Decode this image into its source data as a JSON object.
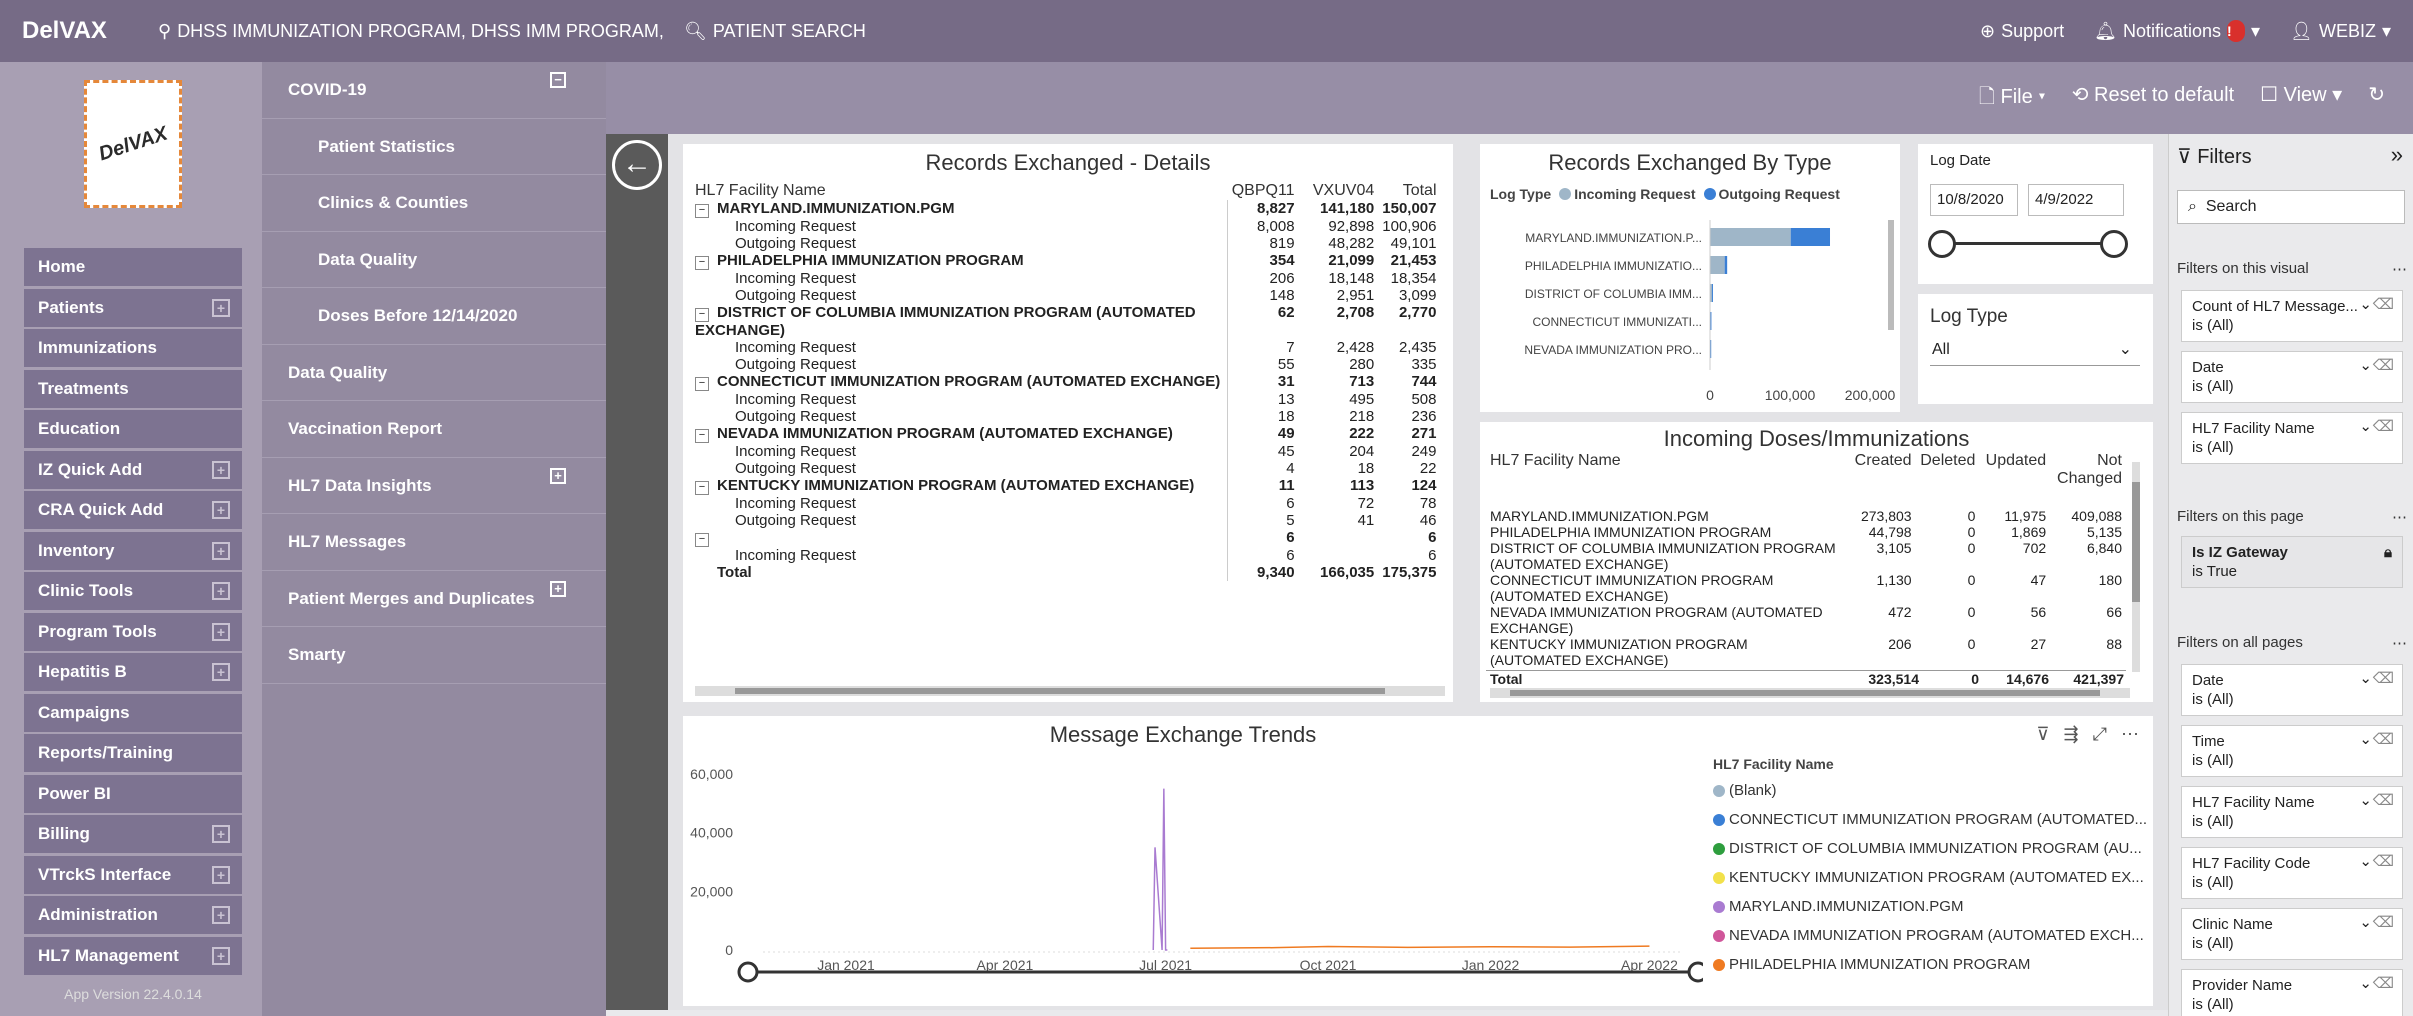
{
  "topbar": {
    "brand": "DelVAX",
    "location": "DHSS IMMUNIZATION PROGRAM, DHSS IMM PROGRAM,",
    "patient_search": "PATIENT SEARCH",
    "support": "Support",
    "notifications": "Notifications",
    "notifications_badge": "!",
    "user": "WEBIZ"
  },
  "logo_text": "DelVAX",
  "sidebar": {
    "items": [
      {
        "label": "Home",
        "plus": false
      },
      {
        "label": "Patients",
        "plus": true
      },
      {
        "label": "Immunizations",
        "plus": false
      },
      {
        "label": "Treatments",
        "plus": false
      },
      {
        "label": "Education",
        "plus": false
      },
      {
        "label": "IZ Quick Add",
        "plus": true
      },
      {
        "label": "CRA Quick Add",
        "plus": true
      },
      {
        "label": "Inventory",
        "plus": true
      },
      {
        "label": "Clinic Tools",
        "plus": true
      },
      {
        "label": "Program Tools",
        "plus": true
      },
      {
        "label": "Hepatitis B",
        "plus": true
      },
      {
        "label": "Campaigns",
        "plus": false
      },
      {
        "label": "Reports/Training",
        "plus": false
      },
      {
        "label": "Power BI",
        "plus": false
      },
      {
        "label": "Billing",
        "plus": true
      },
      {
        "label": "VTrckS Interface",
        "plus": true
      },
      {
        "label": "Administration",
        "plus": true
      },
      {
        "label": "HL7 Management",
        "plus": true
      }
    ],
    "app_version": "App Version 22.4.0.14"
  },
  "subnav": {
    "items": [
      {
        "label": "COVID-19",
        "child": false,
        "icon": "minus"
      },
      {
        "label": "Patient Statistics",
        "child": true
      },
      {
        "label": "Clinics & Counties",
        "child": true
      },
      {
        "label": "Data Quality",
        "child": true
      },
      {
        "label": "Doses Before 12/14/2020",
        "child": true
      },
      {
        "label": "Data Quality",
        "child": false
      },
      {
        "label": "Vaccination Report",
        "child": false
      },
      {
        "label": "HL7 Data Insights",
        "child": false,
        "icon": "plus"
      },
      {
        "label": "HL7 Messages",
        "child": false
      },
      {
        "label": "Patient Merges and Duplicates",
        "child": false,
        "icon": "plus"
      },
      {
        "label": "Smarty",
        "child": false
      }
    ]
  },
  "ribbon": {
    "file": "File",
    "reset": "Reset to default",
    "view": "View"
  },
  "details": {
    "title": "Records Exchanged - Details",
    "headers": [
      "HL7 Facility Name",
      "QBPQ11",
      "VXUV04",
      "Total"
    ],
    "rows": [
      {
        "name": "MARYLAND.IMMUNIZATION.PGM",
        "b": true,
        "toggle": true,
        "q": "8,827",
        "v": "141,180",
        "t": "150,007"
      },
      {
        "name": "Incoming Request",
        "b": false,
        "q": "8,008",
        "v": "92,898",
        "t": "100,906"
      },
      {
        "name": "Outgoing Request",
        "b": false,
        "q": "819",
        "v": "48,282",
        "t": "49,101"
      },
      {
        "name": "PHILADELPHIA IMMUNIZATION PROGRAM",
        "b": true,
        "toggle": true,
        "q": "354",
        "v": "21,099",
        "t": "21,453"
      },
      {
        "name": "Incoming Request",
        "b": false,
        "q": "206",
        "v": "18,148",
        "t": "18,354"
      },
      {
        "name": "Outgoing Request",
        "b": false,
        "q": "148",
        "v": "2,951",
        "t": "3,099"
      },
      {
        "name": "DISTRICT OF COLUMBIA IMMUNIZATION PROGRAM (AUTOMATED EXCHANGE)",
        "b": true,
        "toggle": true,
        "q": "62",
        "v": "2,708",
        "t": "2,770"
      },
      {
        "name": "Incoming Request",
        "b": false,
        "q": "7",
        "v": "2,428",
        "t": "2,435"
      },
      {
        "name": "Outgoing Request",
        "b": false,
        "q": "55",
        "v": "280",
        "t": "335"
      },
      {
        "name": "CONNECTICUT IMMUNIZATION PROGRAM (AUTOMATED EXCHANGE)",
        "b": true,
        "toggle": true,
        "q": "31",
        "v": "713",
        "t": "744"
      },
      {
        "name": "Incoming Request",
        "b": false,
        "q": "13",
        "v": "495",
        "t": "508"
      },
      {
        "name": "Outgoing Request",
        "b": false,
        "q": "18",
        "v": "218",
        "t": "236"
      },
      {
        "name": "NEVADA IMMUNIZATION PROGRAM (AUTOMATED EXCHANGE)",
        "b": true,
        "toggle": true,
        "q": "49",
        "v": "222",
        "t": "271"
      },
      {
        "name": "Incoming Request",
        "b": false,
        "q": "45",
        "v": "204",
        "t": "249"
      },
      {
        "name": "Outgoing Request",
        "b": false,
        "q": "4",
        "v": "18",
        "t": "22"
      },
      {
        "name": "KENTUCKY IMMUNIZATION PROGRAM (AUTOMATED EXCHANGE)",
        "b": true,
        "toggle": true,
        "q": "11",
        "v": "113",
        "t": "124"
      },
      {
        "name": "Incoming Request",
        "b": false,
        "q": "6",
        "v": "72",
        "t": "78"
      },
      {
        "name": "Outgoing Request",
        "b": false,
        "q": "5",
        "v": "41",
        "t": "46"
      },
      {
        "name": "",
        "b": true,
        "toggle": true,
        "q": "6",
        "v": "",
        "t": "6"
      },
      {
        "name": "Incoming Request",
        "b": false,
        "q": "6",
        "v": "",
        "t": "6"
      },
      {
        "name": "Total",
        "b": true,
        "q": "9,340",
        "v": "166,035",
        "t": "175,375"
      }
    ]
  },
  "by_type": {
    "title": "Records Exchanged By Type",
    "legend_label": "Log Type",
    "legend": [
      {
        "name": "Incoming Request",
        "color": "#9fb6c8"
      },
      {
        "name": "Outgoing Request",
        "color": "#3a7fd5"
      }
    ]
  },
  "log_date": {
    "label": "Log Date",
    "from": "10/8/2020",
    "to": "4/9/2022"
  },
  "log_type": {
    "label": "Log Type",
    "value": "All"
  },
  "doses": {
    "title": "Incoming Doses/Immunizations",
    "headers": [
      "HL7 Facility Name",
      "Created",
      "Deleted",
      "Updated",
      "Not Changed"
    ],
    "rows": [
      {
        "name": "MARYLAND.IMMUNIZATION.PGM",
        "c": "273,803",
        "d": "0",
        "u": "11,975",
        "n": "409,088"
      },
      {
        "name": "PHILADELPHIA IMMUNIZATION PROGRAM",
        "c": "44,798",
        "d": "0",
        "u": "1,869",
        "n": "5,135"
      },
      {
        "name": "DISTRICT OF COLUMBIA IMMUNIZATION PROGRAM (AUTOMATED EXCHANGE)",
        "c": "3,105",
        "d": "0",
        "u": "702",
        "n": "6,840"
      },
      {
        "name": "CONNECTICUT IMMUNIZATION PROGRAM (AUTOMATED EXCHANGE)",
        "c": "1,130",
        "d": "0",
        "u": "47",
        "n": "180"
      },
      {
        "name": "NEVADA IMMUNIZATION PROGRAM (AUTOMATED EXCHANGE)",
        "c": "472",
        "d": "0",
        "u": "56",
        "n": "66"
      },
      {
        "name": "KENTUCKY IMMUNIZATION PROGRAM (AUTOMATED EXCHANGE)",
        "c": "206",
        "d": "0",
        "u": "27",
        "n": "88"
      }
    ],
    "total": {
      "name": "Total",
      "c": "323,514",
      "d": "0",
      "u": "14,676",
      "n": "421,397"
    }
  },
  "trends": {
    "title": "Message Exchange Trends",
    "legend_title": "HL7 Facility Name",
    "legend": [
      {
        "name": "(Blank)",
        "color": "#9fb6c8"
      },
      {
        "name": "CONNECTICUT IMMUNIZATION PROGRAM (AUTOMATED...",
        "color": "#3a7fd5"
      },
      {
        "name": "DISTRICT OF COLUMBIA IMMUNIZATION PROGRAM (AU...",
        "color": "#2e9e3e"
      },
      {
        "name": "KENTUCKY IMMUNIZATION PROGRAM (AUTOMATED EX...",
        "color": "#f2e14a"
      },
      {
        "name": "MARYLAND.IMMUNIZATION.PGM",
        "color": "#a97bd1"
      },
      {
        "name": "NEVADA IMMUNIZATION PROGRAM (AUTOMATED EXCH...",
        "color": "#d0569a"
      },
      {
        "name": "PHILADELPHIA IMMUNIZATION PROGRAM",
        "color": "#ef7a21"
      }
    ]
  },
  "filters": {
    "title": "Filters",
    "search": "Search",
    "visual_label": "Filters on this visual",
    "page_label": "Filters on this page",
    "all_label": "Filters on all pages",
    "visual": [
      {
        "name": "Count of HL7 Message...",
        "value": "is (All)"
      },
      {
        "name": "Date",
        "value": "is (All)"
      },
      {
        "name": "HL7 Facility Name",
        "value": "is (All)"
      }
    ],
    "page": [
      {
        "name": "Is IZ Gateway",
        "value": "is True"
      }
    ],
    "all": [
      {
        "name": "Date",
        "value": "is (All)"
      },
      {
        "name": "Time",
        "value": "is (All)"
      },
      {
        "name": "HL7 Facility Name",
        "value": "is (All)"
      },
      {
        "name": "HL7 Facility Code",
        "value": "is (All)"
      },
      {
        "name": "Clinic Name",
        "value": "is (All)"
      },
      {
        "name": "Provider Name",
        "value": "is (All)"
      }
    ]
  },
  "chart_data": [
    {
      "type": "bar",
      "title": "Records Exchanged By Type",
      "orientation": "horizontal",
      "stacked": true,
      "categories": [
        "MARYLAND.IMMUNIZATION.P...",
        "PHILADELPHIA IMMUNIZATIO...",
        "DISTRICT OF COLUMBIA IMM...",
        "CONNECTICUT IMMUNIZATI...",
        "NEVADA IMMUNIZATION PRO..."
      ],
      "series": [
        {
          "name": "Incoming Request",
          "values": [
            100906,
            18354,
            2435,
            508,
            249
          ]
        },
        {
          "name": "Outgoing Request",
          "values": [
            49101,
            3099,
            335,
            236,
            22
          ]
        }
      ],
      "xticks": [
        "0",
        "100,000",
        "200,000"
      ],
      "xlim": [
        0,
        200000
      ]
    },
    {
      "type": "line",
      "title": "Message Exchange Trends",
      "xticks": [
        "Jan 2021",
        "Apr 2021",
        "Jul 2021",
        "Oct 2021",
        "Jan 2022",
        "Apr 2022"
      ],
      "yticks": [
        "60,000",
        "40,000",
        "20,000",
        "0"
      ],
      "ylim": [
        0,
        60000
      ],
      "series": [
        {
          "name": "MARYLAND.IMMUNIZATION.PGM",
          "x": [
            "2021-06-24",
            "2021-06-25",
            "2021-06-29",
            "2021-06-30",
            "2021-07-01",
            "2021-07-02"
          ],
          "y": [
            0,
            35000,
            0,
            55000,
            0,
            0
          ]
        },
        {
          "name": "PHILADELPHIA IMMUNIZATION PROGRAM",
          "x": [
            "2021-07-15",
            "2021-09-01",
            "2021-10-01",
            "2021-11-15",
            "2022-01-01",
            "2022-02-15",
            "2022-04-01"
          ],
          "y": [
            600,
            800,
            1200,
            900,
            1100,
            1000,
            1300
          ]
        }
      ]
    }
  ]
}
